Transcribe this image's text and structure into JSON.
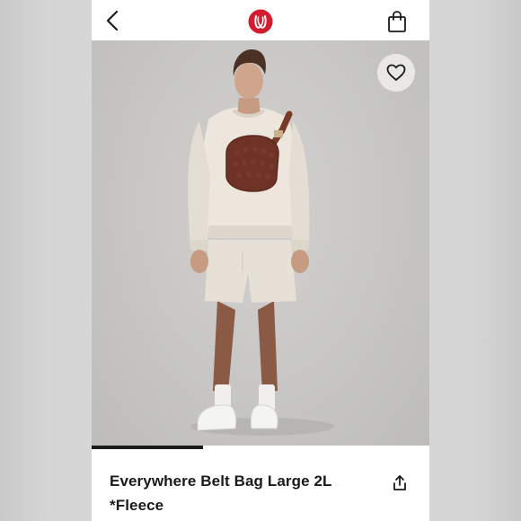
{
  "header": {
    "back_icon": "chevron-left-icon",
    "logo_icon": "lululemon-logo-icon",
    "logo_color": "#d31c2d",
    "cart_icon": "shopping-bag-icon"
  },
  "gallery": {
    "favorite_icon": "heart-outline-icon",
    "progress_fraction": 0.33
  },
  "product": {
    "title": "Everywhere Belt Bag Large 2L *Fleece",
    "share_icon": "share-icon"
  }
}
